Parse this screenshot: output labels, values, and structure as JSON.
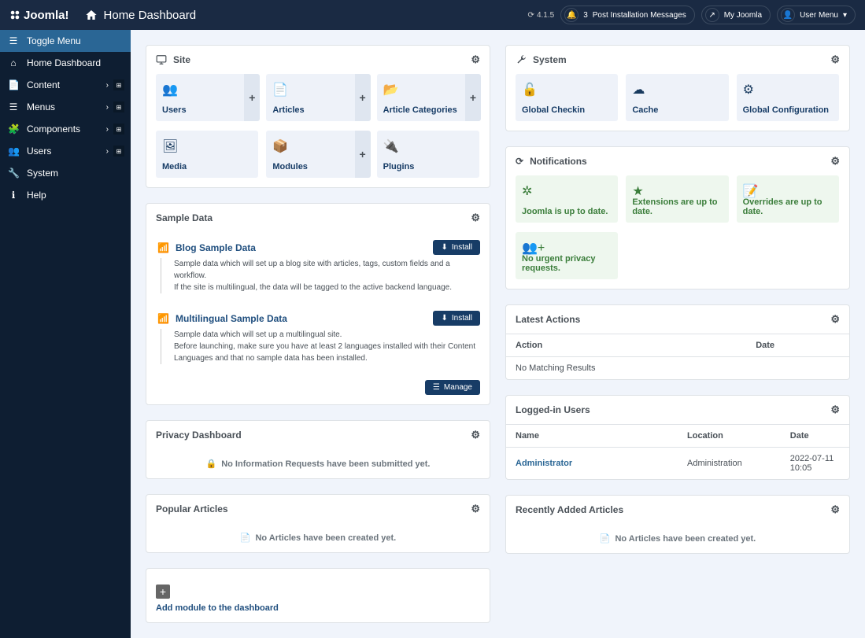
{
  "header": {
    "brand": "Joomla!",
    "page": "Home Dashboard",
    "version": "4.1.5"
  },
  "toppills": {
    "postinstall_count": "3",
    "postinstall": "Post Installation Messages",
    "myjoomla": "My Joomla",
    "usermenu": "User Menu"
  },
  "sidebar": [
    {
      "icon": "bars",
      "label": "Toggle Menu",
      "active": true
    },
    {
      "icon": "home",
      "label": "Home Dashboard"
    },
    {
      "icon": "file",
      "label": "Content",
      "expand": true,
      "grid": true
    },
    {
      "icon": "list",
      "label": "Menus",
      "expand": true,
      "grid": true
    },
    {
      "icon": "puzzle",
      "label": "Components",
      "expand": true,
      "grid": true
    },
    {
      "icon": "users",
      "label": "Users",
      "expand": true,
      "grid": true
    },
    {
      "icon": "wrench",
      "label": "System"
    },
    {
      "icon": "info",
      "label": "Help"
    }
  ],
  "site": {
    "title": "Site",
    "tiles": [
      {
        "icon": "users",
        "label": "Users",
        "plus": true
      },
      {
        "icon": "file",
        "label": "Articles",
        "plus": true
      },
      {
        "icon": "folder",
        "label": "Article Categories",
        "plus": true
      },
      {
        "icon": "image",
        "label": "Media"
      },
      {
        "icon": "cube",
        "label": "Modules",
        "plus": true
      },
      {
        "icon": "plug",
        "label": "Plugins"
      }
    ]
  },
  "system": {
    "title": "System",
    "tiles": [
      {
        "icon": "lockopen",
        "label": "Global Checkin"
      },
      {
        "icon": "cloud",
        "label": "Cache"
      },
      {
        "icon": "cog",
        "label": "Global Configuration"
      }
    ]
  },
  "notifications": {
    "title": "Notifications",
    "tiles": [
      {
        "icon": "joomla",
        "label": "Joomla is up to date."
      },
      {
        "icon": "star",
        "label": "Extensions are up to date."
      },
      {
        "icon": "fileedit",
        "label": "Overrides are up to date."
      },
      {
        "icon": "usersplus",
        "label": "No urgent privacy requests."
      }
    ]
  },
  "sample": {
    "title": "Sample Data",
    "items": [
      {
        "title": "Blog Sample Data",
        "desc": "Sample data which will set up a blog site with articles, tags, custom fields and a workflow.\nIf the site is multilingual, the data will be tagged to the active backend language.",
        "install": "Install"
      },
      {
        "title": "Multilingual Sample Data",
        "desc": "Sample data which will set up a multilingual site.\nBefore launching, make sure you have at least 2 languages installed with their Content Languages and that no sample data has been installed.",
        "install": "Install"
      }
    ],
    "manage": "Manage"
  },
  "privacy": {
    "title": "Privacy Dashboard",
    "empty": "No Information Requests have been submitted yet."
  },
  "popular": {
    "title": "Popular Articles",
    "empty": "No Articles have been created yet."
  },
  "addmod": {
    "label": "Add module to the dashboard"
  },
  "latest": {
    "title": "Latest Actions",
    "cols": {
      "action": "Action",
      "date": "Date"
    },
    "empty": "No Matching Results"
  },
  "logged": {
    "title": "Logged-in Users",
    "cols": {
      "name": "Name",
      "location": "Location",
      "date": "Date"
    },
    "rows": [
      {
        "name": "Administrator",
        "location": "Administration",
        "date": "2022-07-11 10:05"
      }
    ]
  },
  "recent": {
    "title": "Recently Added Articles",
    "empty": "No Articles have been created yet."
  }
}
